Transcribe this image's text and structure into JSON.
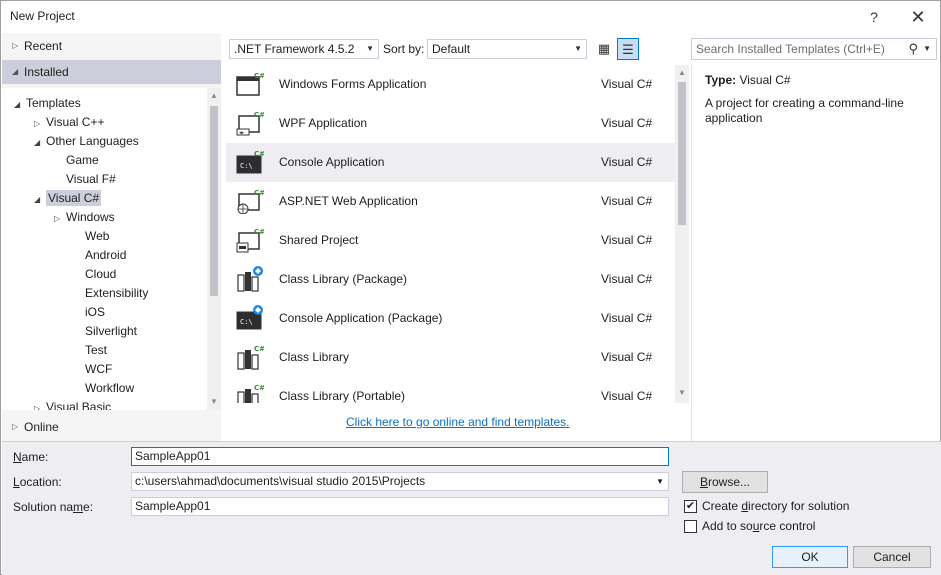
{
  "window": {
    "title": "New Project",
    "help": "?",
    "close": "✕"
  },
  "left": {
    "recent": "Recent",
    "installed": "Installed",
    "online": "Online",
    "tree": [
      {
        "label": "Templates",
        "indent": 0,
        "expander": "open"
      },
      {
        "label": "Visual C++",
        "indent": 1,
        "expander": "closed"
      },
      {
        "label": "Other Languages",
        "indent": 1,
        "expander": "open"
      },
      {
        "label": "Game",
        "indent": 2,
        "expander": "none"
      },
      {
        "label": "Visual F#",
        "indent": 2,
        "expander": "none"
      },
      {
        "label": "Visual C#",
        "indent": 1,
        "expander": "open",
        "selected": true
      },
      {
        "label": "Windows",
        "indent": 2,
        "expander": "closed"
      },
      {
        "label": "Web",
        "indent": 3,
        "expander": "none"
      },
      {
        "label": "Android",
        "indent": 3,
        "expander": "none"
      },
      {
        "label": "Cloud",
        "indent": 3,
        "expander": "none"
      },
      {
        "label": "Extensibility",
        "indent": 3,
        "expander": "none"
      },
      {
        "label": "iOS",
        "indent": 3,
        "expander": "none"
      },
      {
        "label": "Silverlight",
        "indent": 3,
        "expander": "none"
      },
      {
        "label": "Test",
        "indent": 3,
        "expander": "none"
      },
      {
        "label": "WCF",
        "indent": 3,
        "expander": "none"
      },
      {
        "label": "Workflow",
        "indent": 3,
        "expander": "none"
      },
      {
        "label": "Visual Basic",
        "indent": 1,
        "expander": "closed"
      }
    ]
  },
  "toolbar": {
    "framework": ".NET Framework 4.5.2",
    "sort_label": "Sort by:",
    "sort_value": "Default",
    "search_placeholder": "Search Installed Templates (Ctrl+E)"
  },
  "templates": [
    {
      "name": "Windows Forms Application",
      "lang": "Visual C#",
      "icon": "windows-forms-icon"
    },
    {
      "name": "WPF Application",
      "lang": "Visual C#",
      "icon": "wpf-icon"
    },
    {
      "name": "Console Application",
      "lang": "Visual C#",
      "icon": "console-icon",
      "selected": true
    },
    {
      "name": "ASP.NET Web Application",
      "lang": "Visual C#",
      "icon": "web-app-icon"
    },
    {
      "name": "Shared Project",
      "lang": "Visual C#",
      "icon": "shared-project-icon"
    },
    {
      "name": "Class Library (Package)",
      "lang": "Visual C#",
      "icon": "class-library-package-icon"
    },
    {
      "name": "Console Application (Package)",
      "lang": "Visual C#",
      "icon": "console-package-icon"
    },
    {
      "name": "Class Library",
      "lang": "Visual C#",
      "icon": "class-library-icon"
    },
    {
      "name": "Class Library (Portable)",
      "lang": "Visual C#",
      "icon": "class-library-portable-icon"
    }
  ],
  "online_link": "Click here to go online and find templates.",
  "info": {
    "type_label": "Type:",
    "type_value": "Visual C#",
    "description": "A project for creating a command-line application"
  },
  "form": {
    "name_label_u": "N",
    "name_label_rest": "ame:",
    "name_value": "SampleApp01",
    "location_label_u": "L",
    "location_label_rest": "ocation:",
    "location_value": "c:\\users\\ahmad\\documents\\visual studio 2015\\Projects",
    "solution_label_pre": "Solution na",
    "solution_label_u": "m",
    "solution_label_rest": "e:",
    "solution_value": "SampleApp01",
    "browse_pre": "B",
    "browse_rest": "rowse...",
    "create_dir_pre": "Create ",
    "create_dir_u": "d",
    "create_dir_rest": "irectory for solution",
    "create_dir_checked": true,
    "source_control_pre": "Add to so",
    "source_control_u": "u",
    "source_control_rest": "rce control",
    "source_control_checked": false,
    "ok": "OK",
    "cancel": "Cancel"
  },
  "colors": {
    "accent": "#007acc",
    "selection": "#cccedb",
    "link": "#0e70c0",
    "csharp_green": "#388a34"
  }
}
